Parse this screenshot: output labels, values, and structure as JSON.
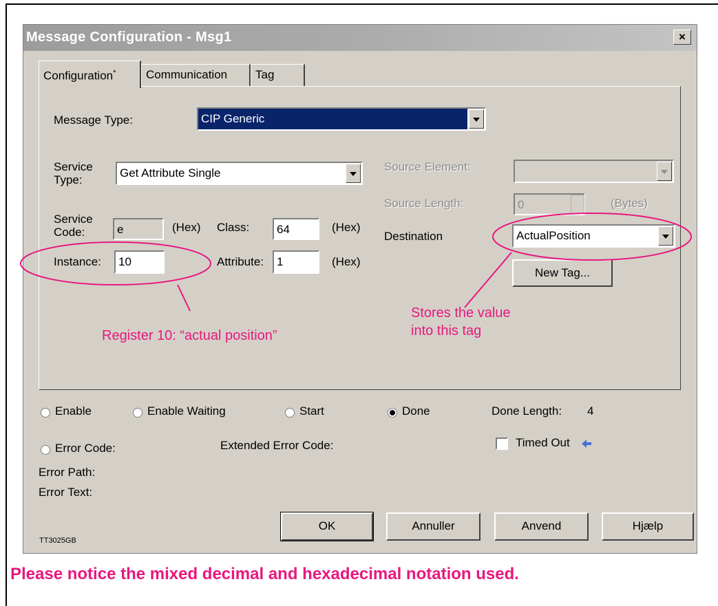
{
  "window": {
    "title": "Message Configuration - Msg1",
    "close_glyph": "×"
  },
  "tabs": [
    {
      "label": "Configuration",
      "marker": "*"
    },
    {
      "label": "Communication"
    },
    {
      "label": "Tag"
    }
  ],
  "config": {
    "message_type_label": "Message Type:",
    "message_type_value": "CIP Generic",
    "service_type_label_1": "Service",
    "service_type_label_2": "Type:",
    "service_type_value": "Get Attribute Single",
    "service_code_label_1": "Service",
    "service_code_label_2": "Code:",
    "service_code_value": "e",
    "hex_label": "(Hex)",
    "class_label": "Class:",
    "class_value": "64",
    "instance_label": "Instance:",
    "instance_value": "10",
    "attribute_label": "Attribute:",
    "attribute_value": "1",
    "source_element_label": "Source Element:",
    "source_element_value": "",
    "source_length_label": "Source Length:",
    "source_length_value": "0",
    "bytes_label": "(Bytes)",
    "destination_label": "Destination",
    "destination_value": "ActualPosition",
    "new_tag_label": "New Tag..."
  },
  "annotations": {
    "register_note": "Register 10: “actual position”",
    "tag_note_1": "Stores the value",
    "tag_note_2": "into this tag"
  },
  "status": {
    "enable_label": "Enable",
    "enable_waiting_label": "Enable Waiting",
    "start_label": "Start",
    "done_label": "Done",
    "done_selected": true,
    "done_length_label": "Done Length:",
    "done_length_value": "4",
    "error_code_label": "Error Code:",
    "extended_error_label": "Extended Error Code:",
    "timed_out_label": "Timed Out",
    "timed_out_checked": false,
    "error_path_label": "Error Path:",
    "error_text_label": "Error Text:"
  },
  "buttons": {
    "ok": "OK",
    "cancel": "Annuller",
    "apply": "Anvend",
    "help": "Hjælp"
  },
  "figure_code": "TT3025GB",
  "footnote": "Please notice the mixed decimal and hexadecimal notation used.",
  "colors": {
    "accent": "#e8177e",
    "selection": "#0a246a",
    "dialog_face": "#d4d0c8",
    "timed_out_marker": "#4a6fd4"
  },
  "icons": {
    "timed_out_marker": "blue-arrow-icon",
    "combo_arrow": "chevron-down-icon"
  }
}
